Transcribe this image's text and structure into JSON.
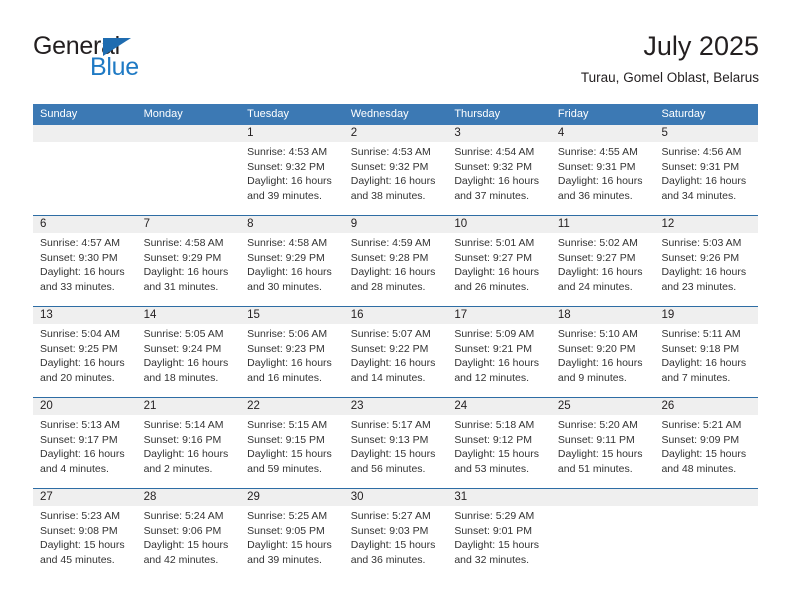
{
  "brand": {
    "name_top": "General",
    "name_bottom": "Blue",
    "triangle_icon": "triangle-logo-icon",
    "colors": {
      "dark": "#231f20",
      "blue": "#1f7ac4",
      "triangle": "#1f6cb0"
    }
  },
  "header": {
    "title": "July 2025",
    "subtitle": "Turau, Gomel Oblast, Belarus"
  },
  "theme": {
    "header_bar": "#3c79b4",
    "week_divider": "#2e6da4",
    "daynum_band": "#efefef",
    "text": "#231f20"
  },
  "weekdays": [
    "Sunday",
    "Monday",
    "Tuesday",
    "Wednesday",
    "Thursday",
    "Friday",
    "Saturday"
  ],
  "weeks": [
    [
      {
        "day": "",
        "lines": [
          "",
          "",
          "",
          ""
        ]
      },
      {
        "day": "",
        "lines": [
          "",
          "",
          "",
          ""
        ]
      },
      {
        "day": "1",
        "lines": [
          "Sunrise: 4:53 AM",
          "Sunset: 9:32 PM",
          "Daylight: 16 hours",
          "and 39 minutes."
        ]
      },
      {
        "day": "2",
        "lines": [
          "Sunrise: 4:53 AM",
          "Sunset: 9:32 PM",
          "Daylight: 16 hours",
          "and 38 minutes."
        ]
      },
      {
        "day": "3",
        "lines": [
          "Sunrise: 4:54 AM",
          "Sunset: 9:32 PM",
          "Daylight: 16 hours",
          "and 37 minutes."
        ]
      },
      {
        "day": "4",
        "lines": [
          "Sunrise: 4:55 AM",
          "Sunset: 9:31 PM",
          "Daylight: 16 hours",
          "and 36 minutes."
        ]
      },
      {
        "day": "5",
        "lines": [
          "Sunrise: 4:56 AM",
          "Sunset: 9:31 PM",
          "Daylight: 16 hours",
          "and 34 minutes."
        ]
      }
    ],
    [
      {
        "day": "6",
        "lines": [
          "Sunrise: 4:57 AM",
          "Sunset: 9:30 PM",
          "Daylight: 16 hours",
          "and 33 minutes."
        ]
      },
      {
        "day": "7",
        "lines": [
          "Sunrise: 4:58 AM",
          "Sunset: 9:29 PM",
          "Daylight: 16 hours",
          "and 31 minutes."
        ]
      },
      {
        "day": "8",
        "lines": [
          "Sunrise: 4:58 AM",
          "Sunset: 9:29 PM",
          "Daylight: 16 hours",
          "and 30 minutes."
        ]
      },
      {
        "day": "9",
        "lines": [
          "Sunrise: 4:59 AM",
          "Sunset: 9:28 PM",
          "Daylight: 16 hours",
          "and 28 minutes."
        ]
      },
      {
        "day": "10",
        "lines": [
          "Sunrise: 5:01 AM",
          "Sunset: 9:27 PM",
          "Daylight: 16 hours",
          "and 26 minutes."
        ]
      },
      {
        "day": "11",
        "lines": [
          "Sunrise: 5:02 AM",
          "Sunset: 9:27 PM",
          "Daylight: 16 hours",
          "and 24 minutes."
        ]
      },
      {
        "day": "12",
        "lines": [
          "Sunrise: 5:03 AM",
          "Sunset: 9:26 PM",
          "Daylight: 16 hours",
          "and 23 minutes."
        ]
      }
    ],
    [
      {
        "day": "13",
        "lines": [
          "Sunrise: 5:04 AM",
          "Sunset: 9:25 PM",
          "Daylight: 16 hours",
          "and 20 minutes."
        ]
      },
      {
        "day": "14",
        "lines": [
          "Sunrise: 5:05 AM",
          "Sunset: 9:24 PM",
          "Daylight: 16 hours",
          "and 18 minutes."
        ]
      },
      {
        "day": "15",
        "lines": [
          "Sunrise: 5:06 AM",
          "Sunset: 9:23 PM",
          "Daylight: 16 hours",
          "and 16 minutes."
        ]
      },
      {
        "day": "16",
        "lines": [
          "Sunrise: 5:07 AM",
          "Sunset: 9:22 PM",
          "Daylight: 16 hours",
          "and 14 minutes."
        ]
      },
      {
        "day": "17",
        "lines": [
          "Sunrise: 5:09 AM",
          "Sunset: 9:21 PM",
          "Daylight: 16 hours",
          "and 12 minutes."
        ]
      },
      {
        "day": "18",
        "lines": [
          "Sunrise: 5:10 AM",
          "Sunset: 9:20 PM",
          "Daylight: 16 hours",
          "and 9 minutes."
        ]
      },
      {
        "day": "19",
        "lines": [
          "Sunrise: 5:11 AM",
          "Sunset: 9:18 PM",
          "Daylight: 16 hours",
          "and 7 minutes."
        ]
      }
    ],
    [
      {
        "day": "20",
        "lines": [
          "Sunrise: 5:13 AM",
          "Sunset: 9:17 PM",
          "Daylight: 16 hours",
          "and 4 minutes."
        ]
      },
      {
        "day": "21",
        "lines": [
          "Sunrise: 5:14 AM",
          "Sunset: 9:16 PM",
          "Daylight: 16 hours",
          "and 2 minutes."
        ]
      },
      {
        "day": "22",
        "lines": [
          "Sunrise: 5:15 AM",
          "Sunset: 9:15 PM",
          "Daylight: 15 hours",
          "and 59 minutes."
        ]
      },
      {
        "day": "23",
        "lines": [
          "Sunrise: 5:17 AM",
          "Sunset: 9:13 PM",
          "Daylight: 15 hours",
          "and 56 minutes."
        ]
      },
      {
        "day": "24",
        "lines": [
          "Sunrise: 5:18 AM",
          "Sunset: 9:12 PM",
          "Daylight: 15 hours",
          "and 53 minutes."
        ]
      },
      {
        "day": "25",
        "lines": [
          "Sunrise: 5:20 AM",
          "Sunset: 9:11 PM",
          "Daylight: 15 hours",
          "and 51 minutes."
        ]
      },
      {
        "day": "26",
        "lines": [
          "Sunrise: 5:21 AM",
          "Sunset: 9:09 PM",
          "Daylight: 15 hours",
          "and 48 minutes."
        ]
      }
    ],
    [
      {
        "day": "27",
        "lines": [
          "Sunrise: 5:23 AM",
          "Sunset: 9:08 PM",
          "Daylight: 15 hours",
          "and 45 minutes."
        ]
      },
      {
        "day": "28",
        "lines": [
          "Sunrise: 5:24 AM",
          "Sunset: 9:06 PM",
          "Daylight: 15 hours",
          "and 42 minutes."
        ]
      },
      {
        "day": "29",
        "lines": [
          "Sunrise: 5:25 AM",
          "Sunset: 9:05 PM",
          "Daylight: 15 hours",
          "and 39 minutes."
        ]
      },
      {
        "day": "30",
        "lines": [
          "Sunrise: 5:27 AM",
          "Sunset: 9:03 PM",
          "Daylight: 15 hours",
          "and 36 minutes."
        ]
      },
      {
        "day": "31",
        "lines": [
          "Sunrise: 5:29 AM",
          "Sunset: 9:01 PM",
          "Daylight: 15 hours",
          "and 32 minutes."
        ]
      },
      {
        "day": "",
        "lines": [
          "",
          "",
          "",
          ""
        ]
      },
      {
        "day": "",
        "lines": [
          "",
          "",
          "",
          ""
        ]
      }
    ]
  ]
}
